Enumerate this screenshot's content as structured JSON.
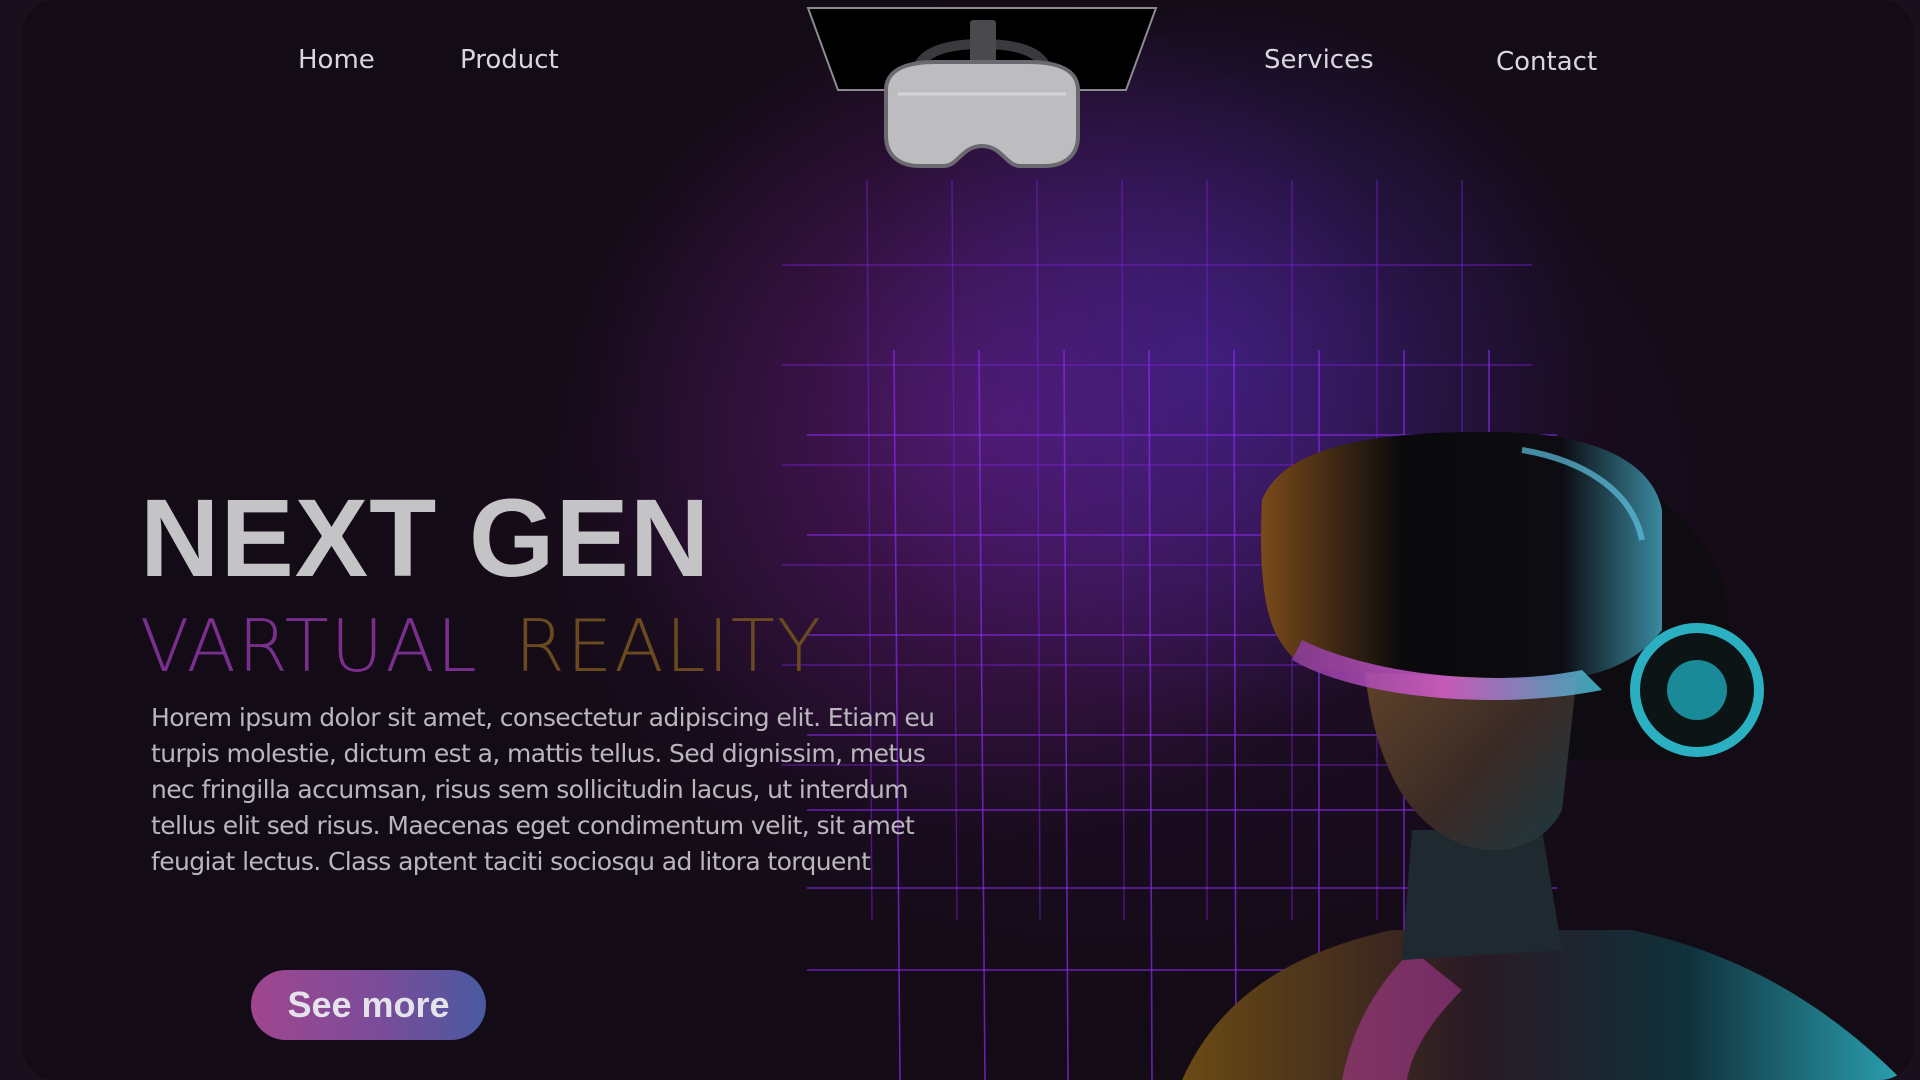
{
  "nav": {
    "items": [
      {
        "label": "Home"
      },
      {
        "label": "Product"
      },
      {
        "label": "Services"
      },
      {
        "label": "Contact"
      }
    ],
    "logo_icon": "vr-headset-icon"
  },
  "hero": {
    "title": "NEXT GEN",
    "subtitle_word1": "VARTUAL",
    "subtitle_word2": "REALITY",
    "body": "Horem ipsum dolor sit amet, consectetur adipiscing elit. Etiam eu turpis molestie, dictum est a, mattis tellus. Sed dignissim, metus nec fringilla accumsan, risus sem sollicitudin lacus, ut interdum tellus elit sed risus. Maecenas eget condimentum velit, sit amet feugiat lectus. Class aptent taciti sociosqu ad litora torquent",
    "cta_label": "See more"
  },
  "colors": {
    "background": "#130b15",
    "title": "#c4c4c6",
    "subtitle_purple": "#7a2f8e",
    "subtitle_gold": "#6a4a1e",
    "grid": "#7a1fd6",
    "cta_start": "#a0468e",
    "cta_end": "#4a5aa0"
  },
  "images": {
    "hero_person": "person-wearing-vr-headset"
  }
}
